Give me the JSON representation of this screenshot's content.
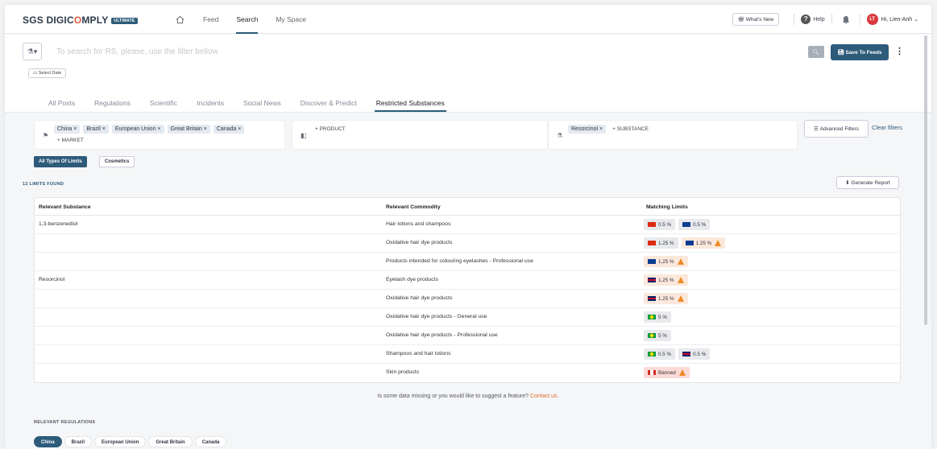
{
  "header": {
    "logo_text": "SGS DIGIC",
    "logo_o": "O",
    "logo_rest": "MPLY",
    "logo_badge": "ULTIMATE",
    "nav": [
      "Feed",
      "Search",
      "My Space"
    ],
    "active_nav": "Search",
    "whats_new": "What's New",
    "help": "Help",
    "avatar_initials": "LT",
    "user_greeting": "Hi, Lien-Anh"
  },
  "search": {
    "placeholder": "To search for RS, please, use the filter bellow",
    "save_label": "Save To Feeds",
    "select_date": "Select Date"
  },
  "tabs": [
    "All Posts",
    "Regulations",
    "Scientific",
    "Incidents",
    "Social News",
    "Discover & Predict",
    "Restricted Substances"
  ],
  "active_tab": "Restricted Substances",
  "filters": {
    "markets": [
      "China ×",
      "Brazil ×",
      "European Union ×",
      "Great Britain ×",
      "Canada ×"
    ],
    "add_market": "+ MARKET",
    "add_product": "+ PRODUCT",
    "substances": [
      "Resorcinol ×"
    ],
    "add_substance": "+ SUBSTANCE",
    "advanced": "Advanced Filters",
    "clear": "Clear filters"
  },
  "limit_tabs": [
    "All Types Of Limits",
    "Cosmetics"
  ],
  "found_label": "12 LIMITS FOUND",
  "generate_report": "Generate Report",
  "table": {
    "headers": [
      "Relevant Substance",
      "Relevant Commodity",
      "Matching Limits"
    ],
    "rows": [
      {
        "substance": "1,3-benzenediol",
        "commodity": "Hair lotions and shampoos",
        "limits": [
          {
            "flag": "cn",
            "value": "0.5 %",
            "warn": false
          },
          {
            "flag": "eu",
            "value": "0.5 %",
            "warn": false
          }
        ]
      },
      {
        "substance": "",
        "commodity": "Oxidative hair dye products",
        "limits": [
          {
            "flag": "cn",
            "value": "1.25 %",
            "warn": false
          },
          {
            "flag": "eu",
            "value": "1.25 %",
            "warn": true
          }
        ]
      },
      {
        "substance": "",
        "commodity": "Products intended for colouring eyelashes - Professional use",
        "limits": [
          {
            "flag": "eu",
            "value": "1,25 %",
            "warn": true
          }
        ]
      },
      {
        "substance": "Resorcinol",
        "commodity": "Eyelash dye products",
        "limits": [
          {
            "flag": "gb",
            "value": "1,25 %",
            "warn": true
          }
        ]
      },
      {
        "substance": "",
        "commodity": "Oxidative hair dye products",
        "limits": [
          {
            "flag": "gb",
            "value": "1.25 %",
            "warn": true
          }
        ]
      },
      {
        "substance": "",
        "commodity": "Oxidative hair dye products - General use",
        "limits": [
          {
            "flag": "br",
            "value": "5 %",
            "warn": false
          }
        ]
      },
      {
        "substance": "",
        "commodity": "Oxidative hair dye products - Professional use",
        "limits": [
          {
            "flag": "br",
            "value": "5 %",
            "warn": false
          }
        ]
      },
      {
        "substance": "",
        "commodity": "Shampoos and hair lotions",
        "limits": [
          {
            "flag": "br",
            "value": "0.5 %",
            "warn": false
          },
          {
            "flag": "gb",
            "value": "0.5 %",
            "warn": false
          }
        ]
      },
      {
        "substance": "",
        "commodity": "Skin products",
        "limits": [
          {
            "flag": "ca",
            "value": "Banned",
            "warn": true,
            "banned": true
          }
        ]
      }
    ]
  },
  "missing_text": "Is some data missing or you would like to suggest a feature? ",
  "contact_link": "Contact us.",
  "relevant_regulations": "RELEVANT REGULATIONS",
  "country_tabs": [
    "China",
    "Brazil",
    "European Union",
    "Great Britain",
    "Canada"
  ],
  "active_country": "China",
  "colors": {
    "accent": "#2d5b7a",
    "warning": "#f08a24",
    "link": "#e46b2a"
  }
}
